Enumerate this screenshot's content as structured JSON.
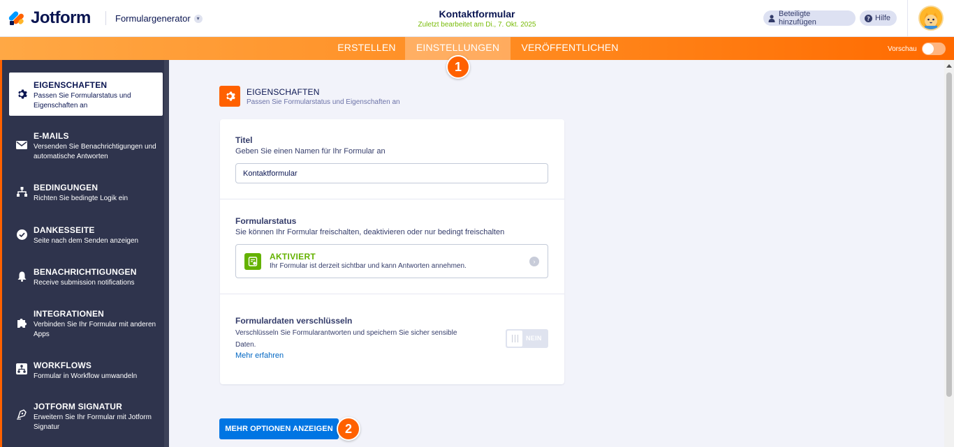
{
  "header": {
    "logo_text": "Jotform",
    "form_builder": "Formulargenerator",
    "form_title": "Kontaktformular",
    "last_edited": "Zuletzt bearbeitet am Di., 7. Okt. 2025",
    "add_participants": "Beteiligte hinzufügen",
    "help": "Hilfe"
  },
  "nav": {
    "tabs": [
      {
        "label": "ERSTELLEN"
      },
      {
        "label": "EINSTELLUNGEN"
      },
      {
        "label": "VERÖFFENTLICHEN"
      }
    ],
    "active_tab": "EINSTELLUNGEN",
    "preview_label": "Vorschau",
    "preview_on": false
  },
  "step_badges": [
    "1",
    "2"
  ],
  "sidebar": {
    "items": [
      {
        "title": "EIGENSCHAFTEN",
        "desc": "Passen Sie Formularstatus und Eigenschaften an",
        "icon": "gear-icon"
      },
      {
        "title": "E-MAILS",
        "desc": "Versenden Sie Benachrichtigungen und automatische Antworten",
        "icon": "envelope-icon"
      },
      {
        "title": "BEDINGUNGEN",
        "desc": "Richten Sie bedingte Logik ein",
        "icon": "sitemap-icon"
      },
      {
        "title": "DANKESSEITE",
        "desc": "Seite nach dem Senden anzeigen",
        "icon": "check-circle-icon"
      },
      {
        "title": "BENACHRICHTIGUNGEN",
        "desc": "Receive submission notifications",
        "icon": "bell-icon"
      },
      {
        "title": "INTEGRATIONEN",
        "desc": "Verbinden Sie Ihr Formular mit anderen Apps",
        "icon": "puzzle-icon"
      },
      {
        "title": "WORKFLOWS",
        "desc": "Formular in Workflow umwandeln",
        "icon": "workflow-icon"
      },
      {
        "title": "JOTFORM SIGNATUR",
        "desc": "Erweitern Sie Ihr Formular mit Jotform Signatur",
        "icon": "pen-icon"
      }
    ]
  },
  "section": {
    "title": "EIGENSCHAFTEN",
    "desc": "Passen Sie Formularstatus und Eigenschaften an"
  },
  "title_field": {
    "label": "Titel",
    "desc": "Geben Sie einen Namen für Ihr Formular an",
    "value": "Kontaktformular"
  },
  "status": {
    "label": "Formularstatus",
    "desc": "Sie können Ihr Formular freischalten, deaktivieren oder nur bedingt freischalten",
    "value": "AKTIVIERT",
    "value_desc": "Ihr Formular ist derzeit sichtbar und kann Antworten annehmen."
  },
  "encrypt": {
    "label": "Formulardaten verschlüsseln",
    "desc": "Verschlüsseln Sie Formularantworten und speichern Sie sicher sensible Daten.",
    "link": "Mehr erfahren",
    "toggle": "NEIN"
  },
  "more_options": "MEHR OPTIONEN ANZEIGEN",
  "colors": {
    "brand_orange": "#ff6100",
    "accent_blue": "#0075e3",
    "success_green": "#64b200",
    "sidebar_bg": "#2f344d"
  }
}
